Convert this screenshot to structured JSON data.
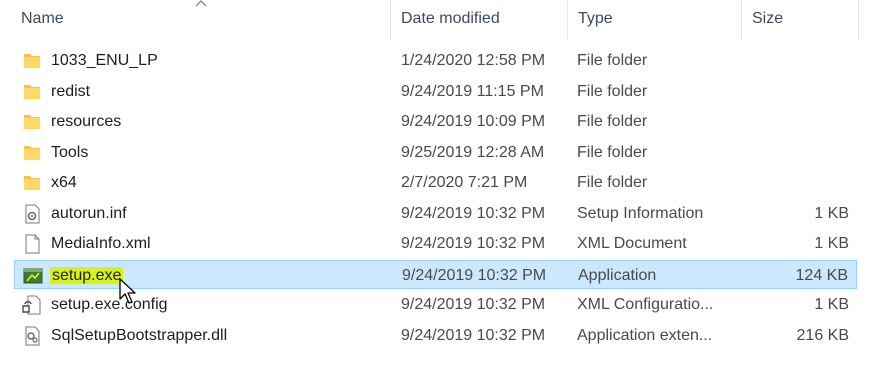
{
  "columns": {
    "name": "Name",
    "date_modified": "Date modified",
    "type": "Type",
    "size": "Size"
  },
  "colors": {
    "folder": "#f6c445",
    "selected_row": "#cce8ff",
    "selected_border": "#99d1ff",
    "name_highlight": "#d6f21a"
  },
  "files": [
    {
      "name": "1033_ENU_LP",
      "date": "1/24/2020 12:58 PM",
      "type": "File folder",
      "size": "",
      "icon": "folder-icon"
    },
    {
      "name": "redist",
      "date": "9/24/2019 11:15 PM",
      "type": "File folder",
      "size": "",
      "icon": "folder-icon"
    },
    {
      "name": "resources",
      "date": "9/24/2019 10:09 PM",
      "type": "File folder",
      "size": "",
      "icon": "folder-icon"
    },
    {
      "name": "Tools",
      "date": "9/25/2019 12:28 AM",
      "type": "File folder",
      "size": "",
      "icon": "folder-icon"
    },
    {
      "name": "x64",
      "date": "2/7/2020 7:21 PM",
      "type": "File folder",
      "size": "",
      "icon": "folder-icon"
    },
    {
      "name": "autorun.inf",
      "date": "9/24/2019 10:32 PM",
      "type": "Setup Information",
      "size": "1 KB",
      "icon": "settings-file-icon"
    },
    {
      "name": "MediaInfo.xml",
      "date": "9/24/2019 10:32 PM",
      "type": "XML Document",
      "size": "1 KB",
      "icon": "document-icon"
    },
    {
      "name": "setup.exe",
      "date": "9/24/2019 10:32 PM",
      "type": "Application",
      "size": "124 KB",
      "icon": "application-icon"
    },
    {
      "name": "setup.exe.config",
      "date": "9/24/2019 10:32 PM",
      "type": "XML Configuratio...",
      "size": "1 KB",
      "icon": "config-file-icon"
    },
    {
      "name": "SqlSetupBootstrapper.dll",
      "date": "9/24/2019 10:32 PM",
      "type": "Application exten...",
      "size": "216 KB",
      "icon": "dll-file-icon"
    }
  ]
}
